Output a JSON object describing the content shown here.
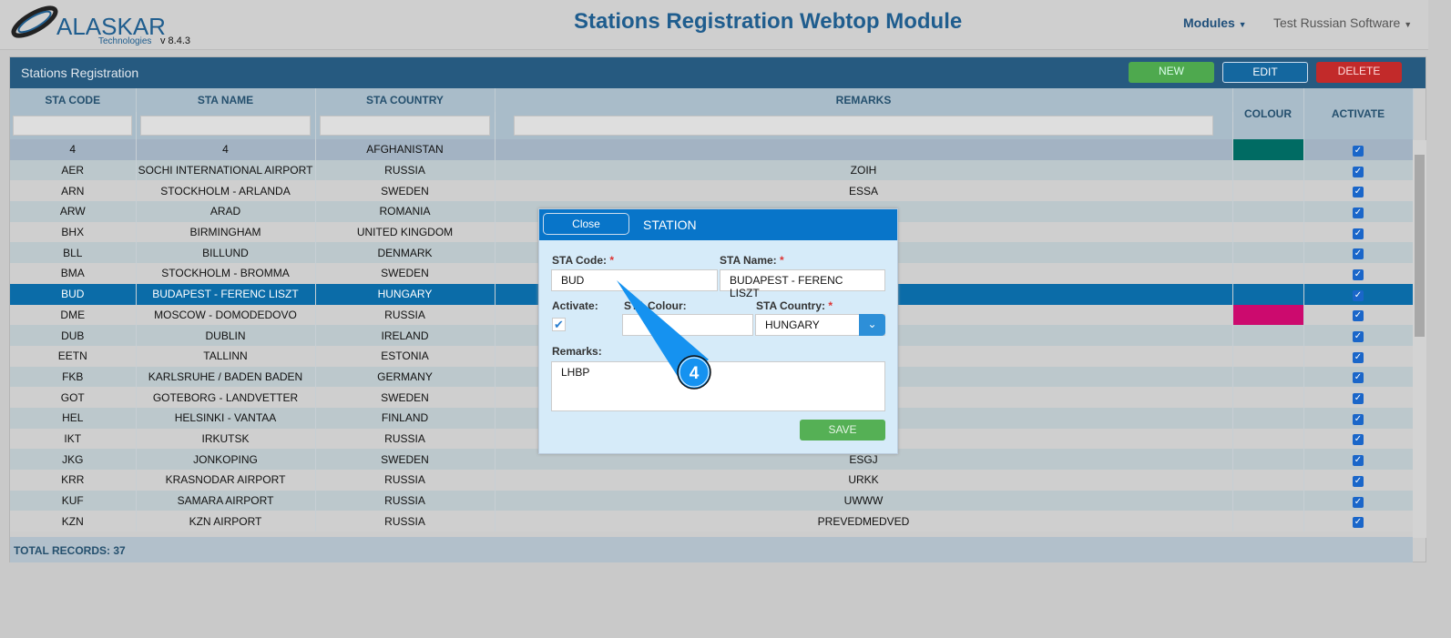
{
  "header": {
    "logo_text": "ALASKAR",
    "logo_sub": "Technologies",
    "version": "v 8.4.3",
    "title": "Stations Registration Webtop Module",
    "nav_modules": "Modules",
    "nav_user": "Test Russian Software"
  },
  "panel": {
    "title": "Stations Registration",
    "new": "NEW",
    "edit": "EDIT",
    "delete": "DELETE",
    "total": "TOTAL RECORDS: 37"
  },
  "columns": [
    "STA CODE",
    "STA NAME",
    "STA COUNTRY",
    "REMARKS",
    "COLOUR",
    "ACTIVATE"
  ],
  "rows": [
    {
      "code": "4",
      "name": "4",
      "country": "AFGHANISTAN",
      "remarks": "",
      "colour": "#006b63"
    },
    {
      "code": "AER",
      "name": "SOCHI INTERNATIONAL AIRPORT",
      "country": "RUSSIA",
      "remarks": "ZOIH",
      "colour": ""
    },
    {
      "code": "ARN",
      "name": "STOCKHOLM - ARLANDA",
      "country": "SWEDEN",
      "remarks": "ESSA",
      "colour": ""
    },
    {
      "code": "ARW",
      "name": "ARAD",
      "country": "ROMANIA",
      "remarks": "",
      "colour": ""
    },
    {
      "code": "BHX",
      "name": "BIRMINGHAM",
      "country": "UNITED KINGDOM",
      "remarks": "",
      "colour": ""
    },
    {
      "code": "BLL",
      "name": "BILLUND",
      "country": "DENMARK",
      "remarks": "",
      "colour": ""
    },
    {
      "code": "BMA",
      "name": "STOCKHOLM - BROMMA",
      "country": "SWEDEN",
      "remarks": "",
      "colour": ""
    },
    {
      "code": "BUD",
      "name": "BUDAPEST - FERENC LISZT",
      "country": "HUNGARY",
      "remarks": "",
      "colour": ""
    },
    {
      "code": "DME",
      "name": "MOSCOW - DOMODEDOVO",
      "country": "RUSSIA",
      "remarks": "",
      "colour": "#cc0a6e"
    },
    {
      "code": "DUB",
      "name": "DUBLIN",
      "country": "IRELAND",
      "remarks": "",
      "colour": ""
    },
    {
      "code": "EETN",
      "name": "TALLINN",
      "country": "ESTONIA",
      "remarks": "",
      "colour": ""
    },
    {
      "code": "FKB",
      "name": "KARLSRUHE / BADEN BADEN",
      "country": "GERMANY",
      "remarks": "",
      "colour": ""
    },
    {
      "code": "GOT",
      "name": "GOTEBORG - LANDVETTER",
      "country": "SWEDEN",
      "remarks": "",
      "colour": ""
    },
    {
      "code": "HEL",
      "name": "HELSINKI - VANTAA",
      "country": "FINLAND",
      "remarks": "",
      "colour": ""
    },
    {
      "code": "IKT",
      "name": "IRKUTSK",
      "country": "RUSSIA",
      "remarks": "",
      "colour": ""
    },
    {
      "code": "JKG",
      "name": "JONKOPING",
      "country": "SWEDEN",
      "remarks": "ESGJ",
      "colour": ""
    },
    {
      "code": "KRR",
      "name": "KRASNODAR AIRPORT",
      "country": "RUSSIA",
      "remarks": "URKK",
      "colour": ""
    },
    {
      "code": "KUF",
      "name": "SAMARA AIRPORT",
      "country": "RUSSIA",
      "remarks": "UWWW",
      "colour": ""
    },
    {
      "code": "KZN",
      "name": "KZN AIRPORT",
      "country": "RUSSIA",
      "remarks": "PREVEDMEDVED",
      "colour": ""
    }
  ],
  "dialog": {
    "close": "Close",
    "title": "STATION",
    "code_label": "STA Code:",
    "code": "BUD",
    "name_label": "STA Name:",
    "name": "BUDAPEST - FERENC LISZT",
    "activate_label": "Activate:",
    "colour_label": "STA Colour:",
    "country_label": "STA Country:",
    "country": "HUNGARY",
    "remarks_label": "Remarks:",
    "remarks": "LHBP",
    "save": "SAVE",
    "required": "*"
  },
  "callout": {
    "number": "4"
  }
}
